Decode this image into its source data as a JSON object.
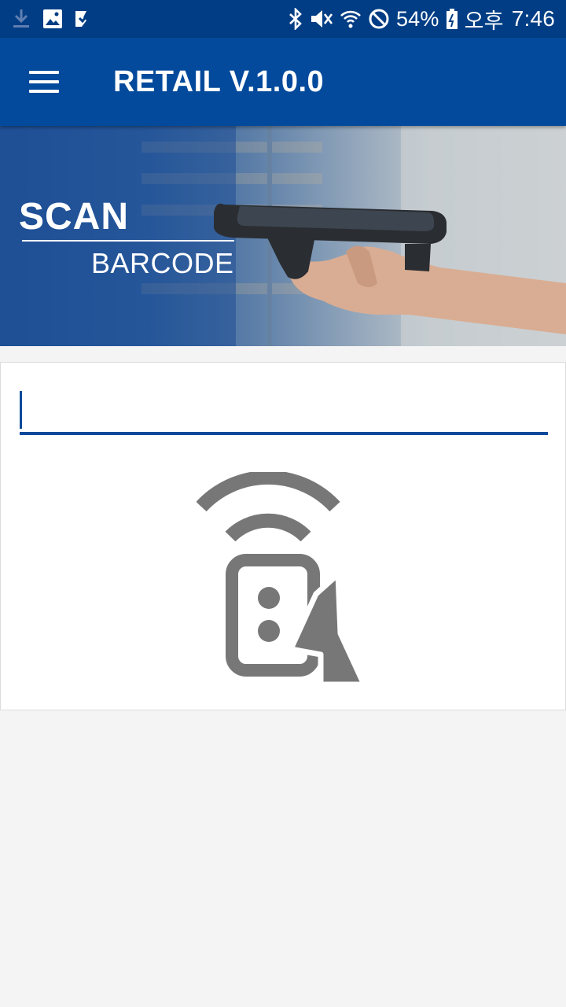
{
  "status_bar": {
    "icons_left": [
      "download-icon",
      "image-icon",
      "check-icon"
    ],
    "icons_right": [
      "bluetooth-icon",
      "mute-icon",
      "wifi-icon",
      "block-icon",
      "battery-icon"
    ],
    "battery": "54%",
    "ampm": "오후",
    "time": "7:46"
  },
  "app_bar": {
    "title": "RETAIL V.1.0.0"
  },
  "banner": {
    "scan": "SCAN",
    "barcode": "BARCODE"
  },
  "scan_field": {
    "value": ""
  },
  "colors": {
    "status_bar": "#003d84",
    "app_bar": "#034a9c",
    "accent": "#0a4a9a",
    "icon_gray": "#777777"
  }
}
